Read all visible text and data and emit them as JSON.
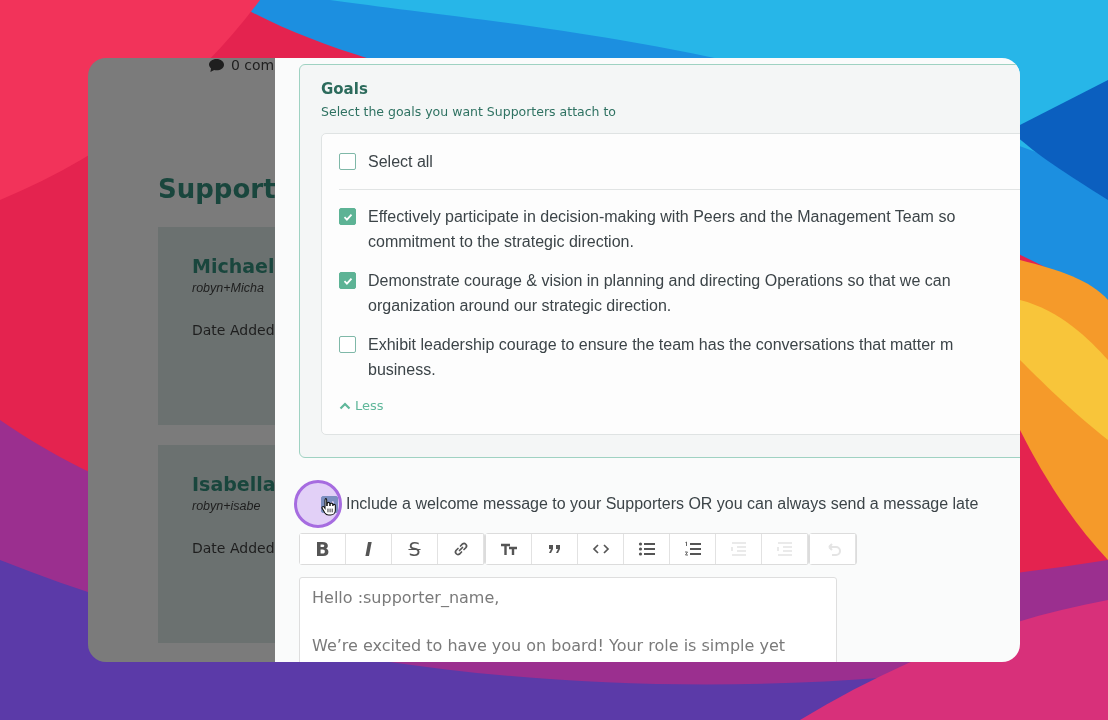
{
  "background_page": {
    "comments": "0 com",
    "heading": "Support",
    "supporters": [
      {
        "name": "Michael",
        "email": "robyn+Micha",
        "date_label": "Date Added"
      },
      {
        "name": "Isabella",
        "email": "robyn+isabe",
        "date_label": "Date Added"
      }
    ]
  },
  "goals": {
    "title": "Goals",
    "subtitle": "Select the goals you want Supporters attach to",
    "select_all": {
      "label": "Select all",
      "checked": false
    },
    "items": [
      {
        "lines": [
          "Effectively participate in decision-making with Peers and the Management Team so",
          "commitment to the strategic direction."
        ],
        "checked": true
      },
      {
        "lines": [
          "Demonstrate courage & vision in planning and directing Operations so that we can",
          "organization around our strategic direction."
        ],
        "checked": true
      },
      {
        "lines": [
          "Exhibit leadership courage to ensure the team has the conversations that matter m",
          "business."
        ],
        "checked": false
      }
    ],
    "toggle": "Less"
  },
  "welcome": {
    "label": "Include a welcome message to your Supporters OR you can always send a message late",
    "checked": true
  },
  "toolbar": [
    [
      {
        "kind": "bold",
        "glyph": "B",
        "disabled": false
      },
      {
        "kind": "italic",
        "glyph": "I",
        "disabled": false
      },
      {
        "kind": "strike",
        "glyph": "S",
        "disabled": false
      },
      {
        "kind": "link",
        "disabled": false
      }
    ],
    [
      {
        "kind": "heading",
        "disabled": false
      },
      {
        "kind": "quote",
        "disabled": false
      },
      {
        "kind": "code",
        "disabled": false
      },
      {
        "kind": "bullets",
        "disabled": false
      },
      {
        "kind": "numbers",
        "disabled": false
      },
      {
        "kind": "outdent",
        "disabled": true
      },
      {
        "kind": "indent",
        "disabled": true
      }
    ],
    [
      {
        "kind": "undo",
        "disabled": true
      }
    ]
  ],
  "editor": {
    "lines": [
      "Hello :supporter_name,",
      "We’re excited to have you on board! Your role is simple yet"
    ]
  }
}
